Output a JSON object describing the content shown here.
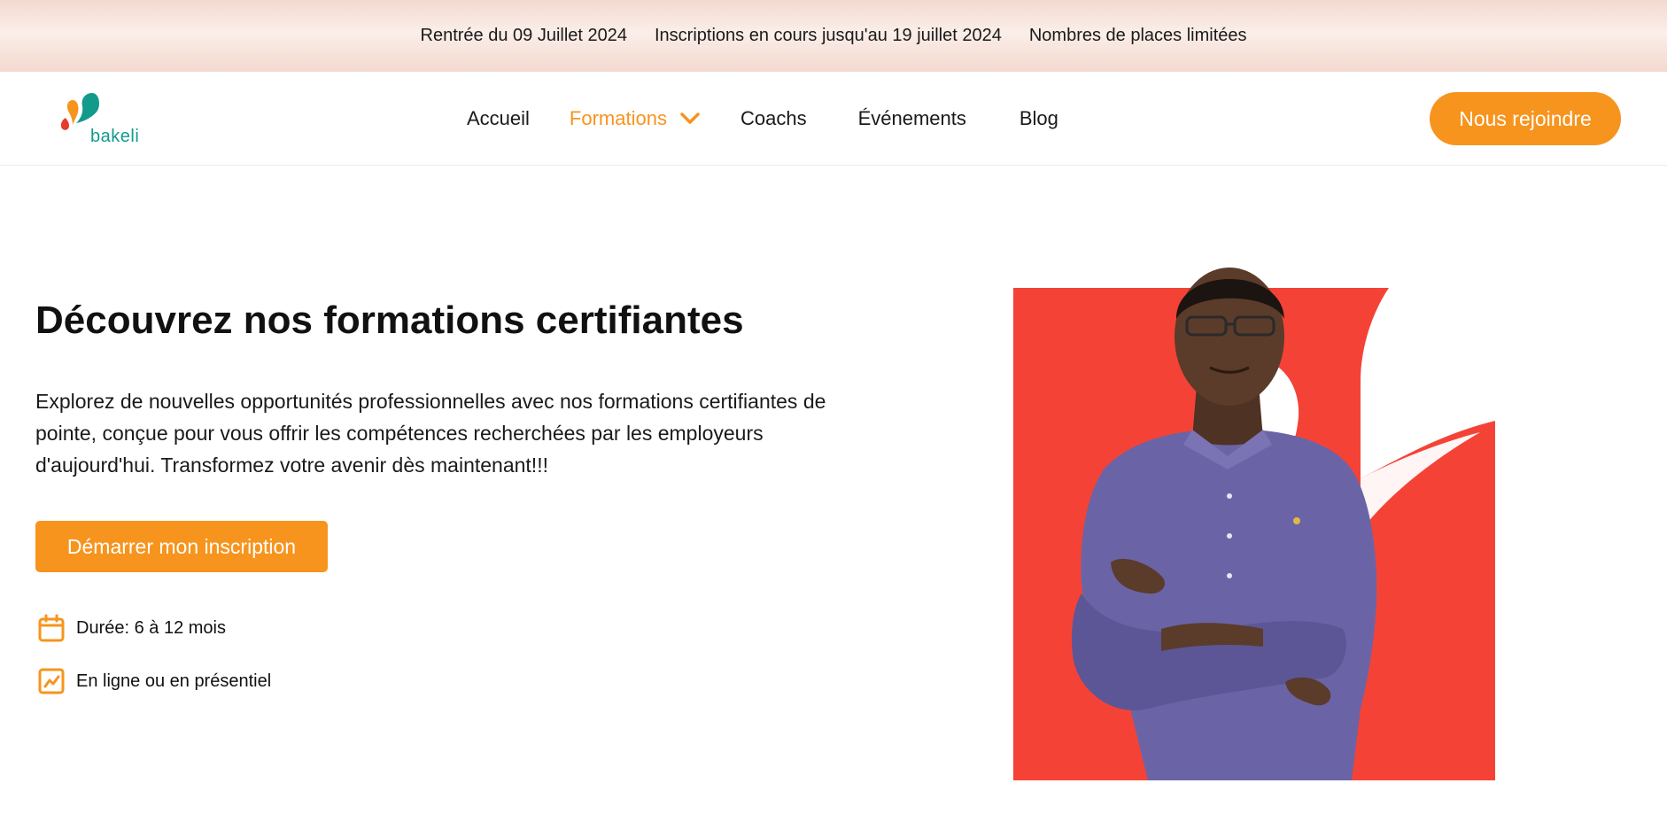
{
  "announcement": {
    "items": [
      "Rentrée du 09 Juillet 2024",
      "Inscriptions en cours jusqu'au 19 juillet 2024",
      "Nombres de places limitées"
    ]
  },
  "header": {
    "logo_text": "bakeli",
    "nav": [
      {
        "label": "Accueil"
      },
      {
        "label": "Formations"
      },
      {
        "label": "Coachs"
      },
      {
        "label": "Événements"
      },
      {
        "label": "Blog"
      }
    ],
    "join_label": "Nous rejoindre"
  },
  "hero": {
    "title": "Découvrez nos formations certifiantes",
    "description": "Explorez de nouvelles opportunités professionnelles avec nos formations certifiantes de pointe, conçue pour vous offrir les compétences recherchées par les employeurs d'aujourd'hui. Transformez votre avenir dès maintenant!!!",
    "cta_label": "Démarrer mon inscription",
    "features": [
      {
        "icon": "calendar-icon",
        "text": "Durée: 6 à 12 mois"
      },
      {
        "icon": "chart-trend-icon",
        "text": "En ligne ou en présentiel"
      }
    ]
  },
  "colors": {
    "accent": "#f7941d",
    "brand_teal": "#139a8c",
    "hero_red": "#f44336",
    "banner": "#f3d9cf"
  }
}
